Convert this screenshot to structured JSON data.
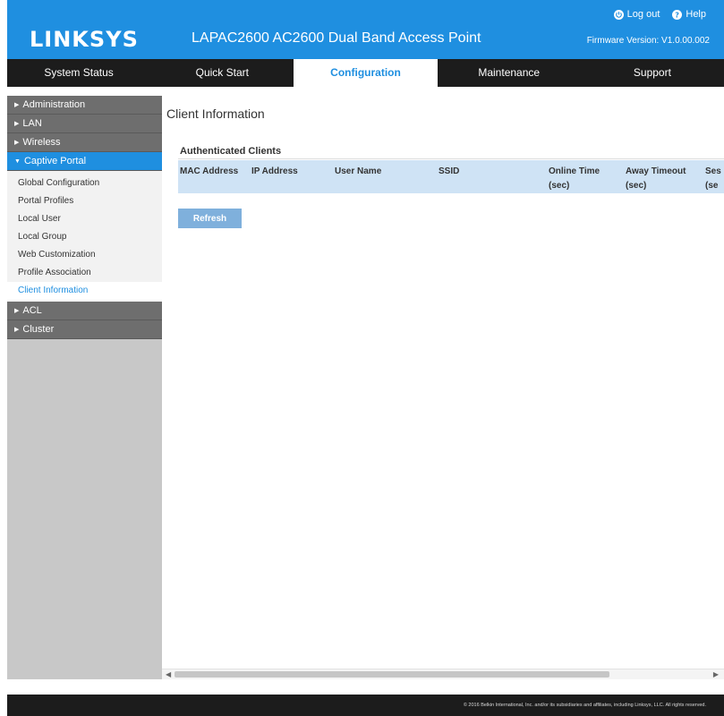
{
  "header": {
    "logo": "LINKSYS",
    "product_title": "LAPAC2600 AC2600 Dual Band Access Point",
    "logout_label": "Log out",
    "help_label": "Help",
    "firmware": "Firmware Version: V1.0.00.002"
  },
  "nav": {
    "tabs": [
      {
        "label": "System Status"
      },
      {
        "label": "Quick Start"
      },
      {
        "label": "Configuration"
      },
      {
        "label": "Maintenance"
      },
      {
        "label": "Support"
      }
    ]
  },
  "sidebar": {
    "sections": [
      {
        "label": "Administration"
      },
      {
        "label": "LAN"
      },
      {
        "label": "Wireless"
      },
      {
        "label": "Captive Portal"
      },
      {
        "label": "ACL"
      },
      {
        "label": "Cluster"
      }
    ],
    "captive_items": [
      {
        "label": "Global Configuration"
      },
      {
        "label": "Portal Profiles"
      },
      {
        "label": "Local User"
      },
      {
        "label": "Local Group"
      },
      {
        "label": "Web Customization"
      },
      {
        "label": "Profile Association"
      },
      {
        "label": "Client Information"
      }
    ]
  },
  "main": {
    "title": "Client Information",
    "section_title": "Authenticated Clients",
    "columns": [
      {
        "label": "MAC Address"
      },
      {
        "label": "IP Address"
      },
      {
        "label": "User Name"
      },
      {
        "label": "SSID"
      },
      {
        "label": "Online Time\n(sec)"
      },
      {
        "label": "Away Timeout\n(sec)"
      },
      {
        "label": "Ses\n(se"
      }
    ],
    "refresh_label": "Refresh"
  },
  "footer": {
    "copyright": "© 2016 Belkin International, Inc. and/or its subsidiaries and affiliates, including Linksys, LLC. All rights reserved."
  },
  "colors": {
    "brand_blue": "#1f8fe0",
    "dark_bar": "#1c1c1c",
    "table_header": "#cfe3f5"
  }
}
